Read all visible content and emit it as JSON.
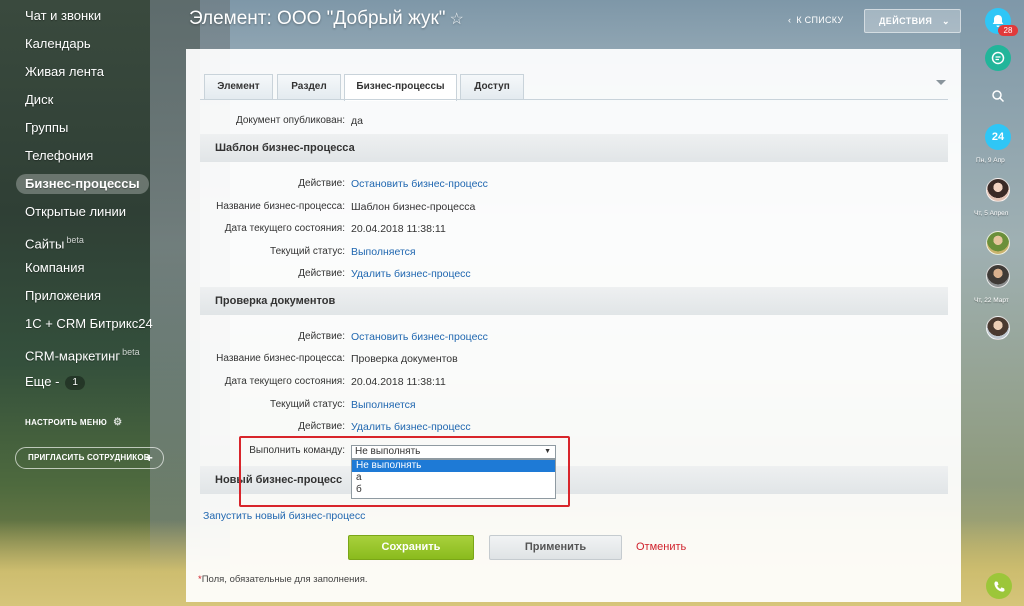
{
  "left_menu": {
    "items": [
      {
        "label": "Чат и звонки"
      },
      {
        "label": "Календарь"
      },
      {
        "label": "Живая лента"
      },
      {
        "label": "Диск"
      },
      {
        "label": "Группы"
      },
      {
        "label": "Телефония"
      },
      {
        "label": "Бизнес-процессы",
        "active": true
      },
      {
        "label": "Открытые линии"
      },
      {
        "label": "Сайты",
        "sup": "beta"
      },
      {
        "label": "Компания"
      },
      {
        "label": "Приложения"
      },
      {
        "label": "1С + CRM Битрикс24"
      },
      {
        "label": "CRM-маркетинг",
        "sup": "beta"
      },
      {
        "label": "Еще -",
        "badge": "1"
      }
    ],
    "configure_label": "НАСТРОИТЬ МЕНЮ",
    "invite_label": "ПРИГЛАСИТЬ СОТРУДНИКОВ"
  },
  "header": {
    "title": "Элемент: ООО \"Добрый жук\"",
    "star": "☆",
    "to_list": "К СПИСКУ",
    "actions": "ДЕЙСТВИЯ"
  },
  "tabs": [
    {
      "label": "Элемент"
    },
    {
      "label": "Раздел"
    },
    {
      "label": "Бизнес-процессы",
      "active": true
    },
    {
      "label": "Доступ"
    }
  ],
  "published": {
    "label": "Документ опубликован:",
    "value": "да"
  },
  "sections": [
    {
      "title": "Шаблон бизнес-процесса",
      "rows": [
        {
          "label": "Действие:",
          "value": "Остановить бизнес-процесс",
          "link": true
        },
        {
          "label": "Название бизнес-процесса:",
          "value": "Шаблон бизнес-процесса",
          "link": false
        },
        {
          "label": "Дата текущего состояния:",
          "value": "20.04.2018 11:38:11",
          "link": false
        },
        {
          "label": "Текущий статус:",
          "value": "Выполняется",
          "link": true
        },
        {
          "label": "Действие:",
          "value": "Удалить бизнес-процесс",
          "link": true
        }
      ]
    },
    {
      "title": "Проверка документов",
      "rows": [
        {
          "label": "Действие:",
          "value": "Остановить бизнес-процесс",
          "link": true
        },
        {
          "label": "Название бизнес-процесса:",
          "value": "Проверка документов",
          "link": false
        },
        {
          "label": "Дата текущего состояния:",
          "value": "20.04.2018 11:38:11",
          "link": false
        },
        {
          "label": "Текущий статус:",
          "value": "Выполняется",
          "link": true
        },
        {
          "label": "Действие:",
          "value": "Удалить бизнес-процесс",
          "link": true
        }
      ]
    },
    {
      "title": "Новый бизнес-процесс",
      "rows": []
    }
  ],
  "command": {
    "label": "Выполнить команду:",
    "selected": "Не выполнять",
    "options": [
      "Не выполнять",
      "а",
      "б"
    ]
  },
  "start_link": "Запустить новый бизнес-процесс",
  "buttons": {
    "save": "Сохранить",
    "apply": "Применить",
    "cancel": "Отменить"
  },
  "required_note": {
    "star": "*",
    "text": "Поля, обязательные для заполнения."
  },
  "right_bar": {
    "notifications_badge": "28",
    "calendar_day": "24",
    "dates": [
      "Пн, 9 Апр",
      "Чт, 5 Апрел",
      "Чт, 22 Март"
    ]
  },
  "colors": {
    "accent_link": "#2067b0",
    "save_green": "#8abb1d",
    "cancel_red": "#d0222c",
    "highlight_red": "#d8252b",
    "select_blue": "#1e7ad6"
  }
}
